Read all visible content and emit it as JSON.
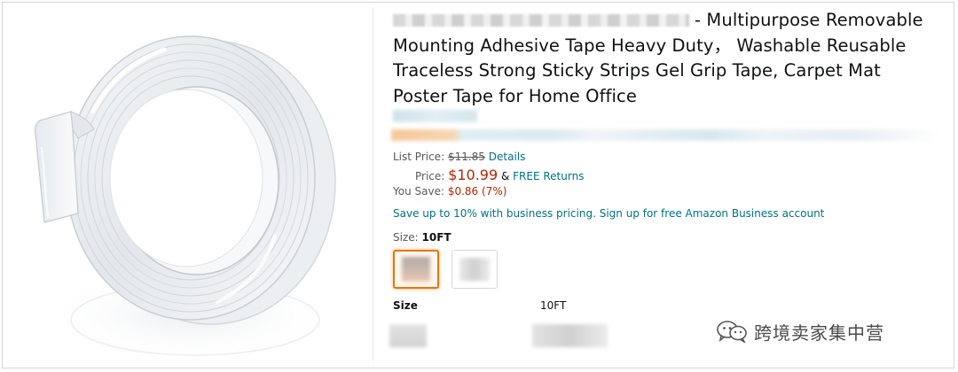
{
  "product": {
    "title_text": "- Multipurpose Removable Mounting Adhesive Tape Heavy Duty， Washable Reusable Traceless Strong Sticky Strips Gel Grip Tape, Carpet Mat Poster Tape for Home Office",
    "image_icon": "tape-roll-image"
  },
  "pricing": {
    "list_price_label": "List Price:",
    "list_price_value": "$11.85",
    "details_link": "Details",
    "price_label": "Price:",
    "price_value": "$10.99",
    "amp": "&",
    "free_returns": "FREE Returns",
    "you_save_label": "You Save:",
    "you_save_value": "$0.86 (7%)"
  },
  "business": {
    "text": "Save up to 10% with business pricing. Sign up for free Amazon Business account"
  },
  "size_selector": {
    "label": "Size:",
    "selected_value": "10FT"
  },
  "specs": {
    "size_header": "Size",
    "size_value": "10FT"
  },
  "watermark": {
    "text": "跨境卖家集中营",
    "icon": "wechat-icon"
  },
  "colors": {
    "link": "#007185",
    "price_red": "#b12704",
    "selected_border": "#e77600",
    "muted": "#565959"
  }
}
